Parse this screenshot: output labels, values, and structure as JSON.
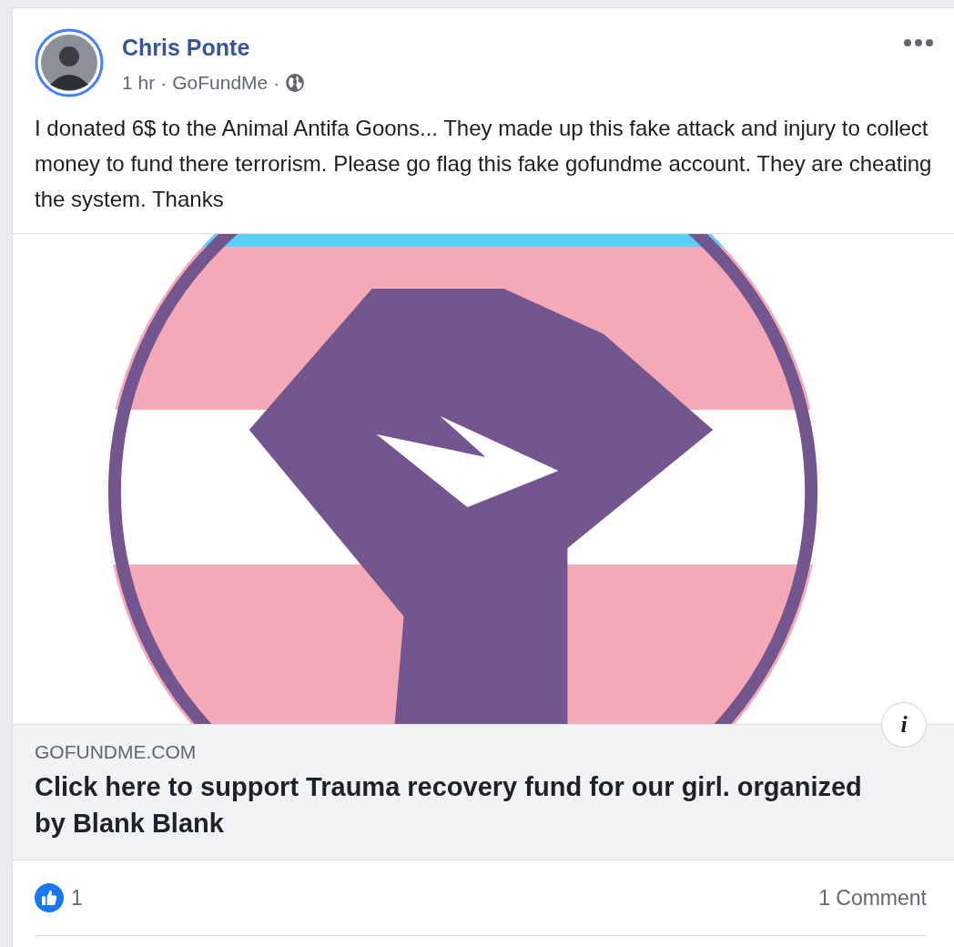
{
  "post": {
    "author": "Chris Ponte",
    "time": "1 hr",
    "source": "GoFundMe",
    "separator": "·",
    "text": "I donated 6$ to the Animal Antifa Goons... They made up this fake attack and injury to collect money to fund there terrorism. Please go flag this fake gofundme account. They are cheating the system. Thanks"
  },
  "link": {
    "kind": "picture",
    "domain": "GOFUNDME.COM",
    "title": "Click here to support Trauma recovery fund for our girl. organized by Blank Blank",
    "info": "i"
  },
  "footer": {
    "likes": "1",
    "comments": "1 Comment"
  }
}
